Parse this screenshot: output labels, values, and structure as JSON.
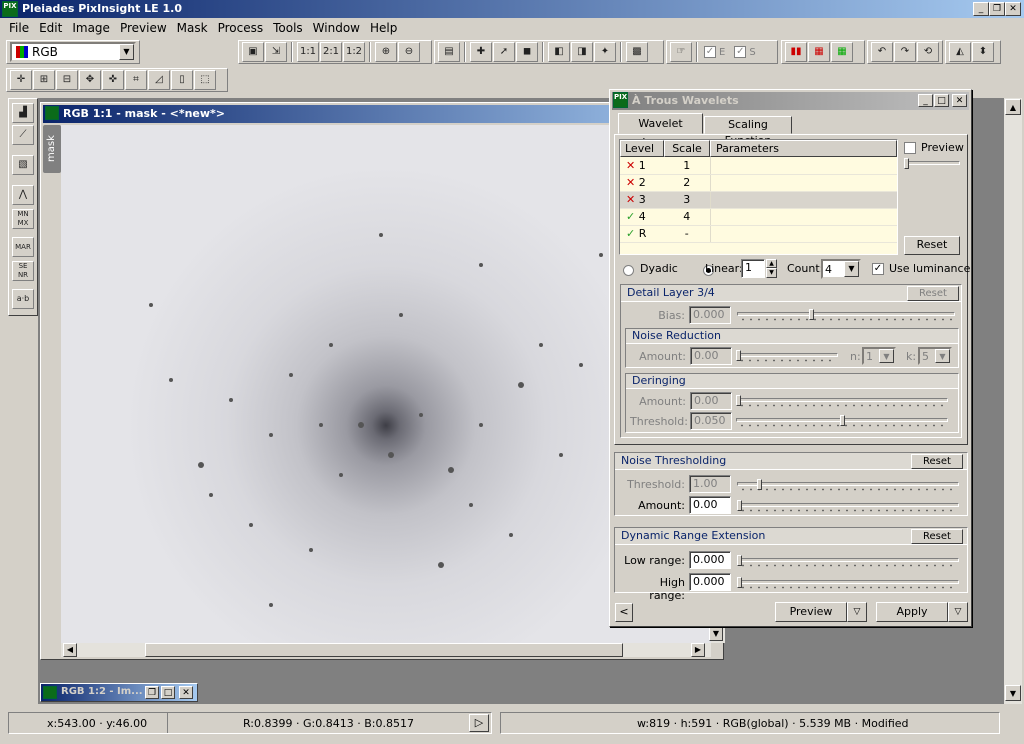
{
  "app": {
    "title": "Pleiades PixInsight LE 1.0",
    "logo": "PIX"
  },
  "caption": {
    "min": "_",
    "max": "❐",
    "close": "✕"
  },
  "menu": [
    "File",
    "Edit",
    "Image",
    "Preview",
    "Mask",
    "Process",
    "Tools",
    "Window",
    "Help"
  ],
  "toolbar": {
    "colorspace": "RGB",
    "rgb_e": "E",
    "rgb_s": "S"
  },
  "image_window": {
    "title": "RGB 1:1 - mask - <*new*>",
    "side_tab": "mask"
  },
  "minimized_window": {
    "title": "RGB 1:2 - Im..."
  },
  "status": {
    "coords": "x:543.00 · y:46.00",
    "values": "R:0.8399 · G:0.8413 · B:0.8517",
    "info": "w:819 · h:591 · RGB(global) · 5.539 MB · Modified"
  },
  "wavelets": {
    "title": "À Trous Wavelets",
    "tabs": [
      "Wavelet Layers",
      "Scaling Function"
    ],
    "columns": [
      "Level",
      "Scale",
      "Parameters"
    ],
    "rows": [
      {
        "level": "1",
        "scale": "1",
        "enabled": false
      },
      {
        "level": "2",
        "scale": "2",
        "enabled": false
      },
      {
        "level": "3",
        "scale": "3",
        "enabled": false
      },
      {
        "level": "4",
        "scale": "4",
        "enabled": true
      },
      {
        "level": "R",
        "scale": "-",
        "enabled": true
      }
    ],
    "preview_label": "Preview",
    "reset": "Reset",
    "dyadic": "Dyadic",
    "linear": "Linear:",
    "linear_value": "1",
    "count_label": "Count:",
    "count_value": "4",
    "use_luminance": "Use luminance",
    "detail_title": "Detail Layer 3/4",
    "bias_label": "Bias:",
    "bias_value": "0.000",
    "noise_red_title": "Noise Reduction",
    "amount_label": "Amount:",
    "nr_amount": "0.00",
    "n_label": "n:",
    "n_value": "1",
    "k_label": "k:",
    "k_value": "5",
    "deringing_title": "Deringing",
    "dr_amount": "0.00",
    "threshold_label": "Threshold:",
    "dr_threshold": "0.050",
    "noise_thr_title": "Noise Thresholding",
    "nt_threshold": "1.00",
    "nt_amount": "0.00",
    "dre_title": "Dynamic Range Extension",
    "low_label": "Low range:",
    "low_value": "0.000",
    "high_label": "High range:",
    "high_value": "0.000",
    "preview_btn": "Preview",
    "apply_btn": "Apply"
  },
  "colors": {
    "title_start": "#0a246a",
    "title_end": "#a6caf0",
    "ok": "#2aa02a",
    "x": "#cc0000"
  }
}
